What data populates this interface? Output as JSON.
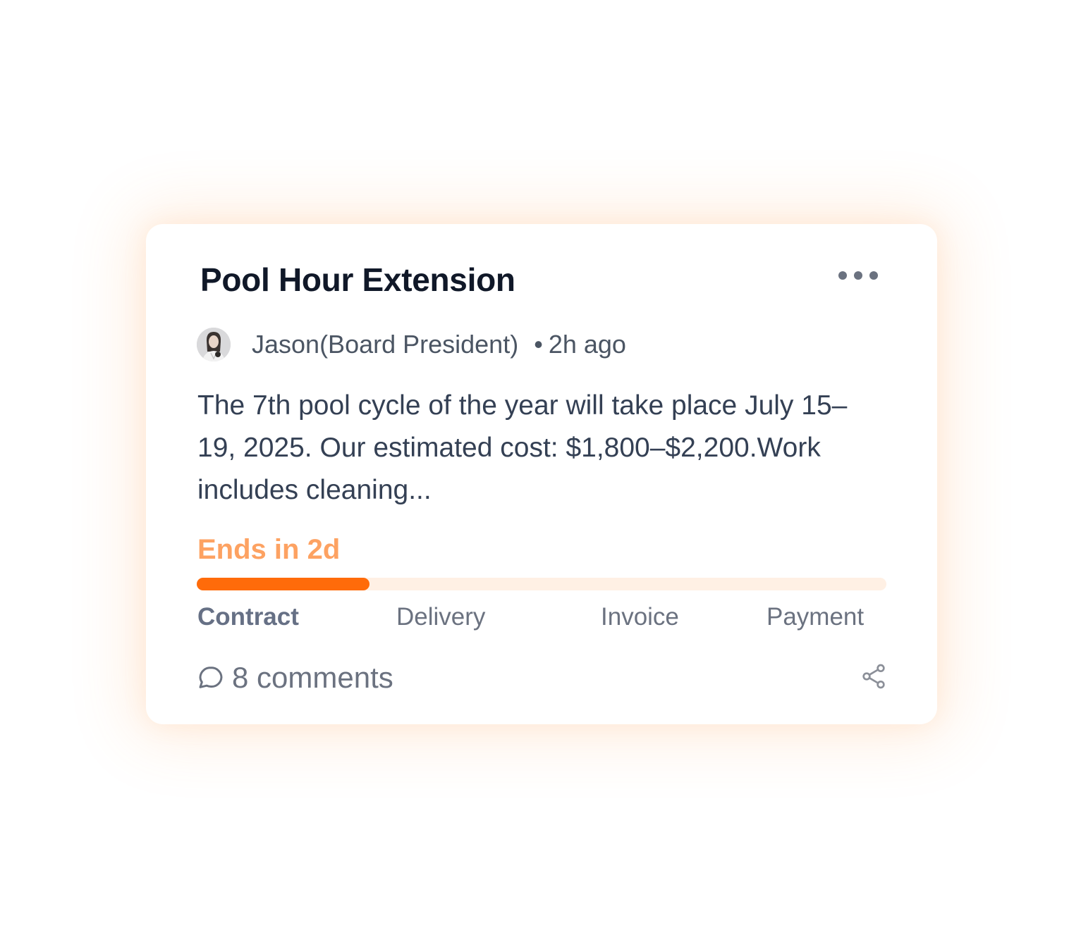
{
  "post": {
    "title": "Pool Hour Extension",
    "author": "Jason(Board President)",
    "separator": "•",
    "time_ago": "2h ago",
    "body": "The 7th pool  cycle of the year will take place July 15–19, 2025. Our estimated cost: $1,800–$2,200.Work includes cleaning..."
  },
  "status": {
    "ends_label": "Ends in 2d",
    "progress": 0.25,
    "stages": [
      "Contract",
      "Delivery",
      "Invoice",
      "Payment"
    ],
    "active_stage": "Contract"
  },
  "footer": {
    "comments_label": "8 comments"
  },
  "icons": {
    "menu": "more-horizontal-icon",
    "comments": "speech-bubble-icon",
    "share": "share-icon"
  },
  "colors": {
    "accent": "#ff6b0a",
    "accent_light": "#fda262",
    "track": "#fff0e4",
    "title": "#101828",
    "text": "#344054",
    "muted": "#6b7280"
  }
}
